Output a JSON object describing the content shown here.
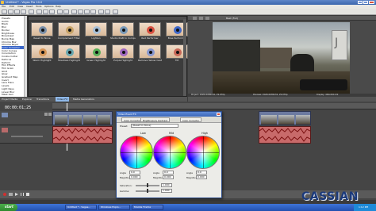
{
  "app": {
    "title": "Untitled * - Vegas Pro 10.0",
    "menu": [
      "File",
      "Edit",
      "View",
      "Insert",
      "Tools",
      "Options",
      "Help"
    ]
  },
  "explorer": {
    "items": [
      "Presets",
      "Audio",
      "Black",
      "Blur",
      "Border",
      "Brightness",
      "Broadcast",
      "Bump Map",
      "Chroma Blur",
      "Chroma Keyer",
      "Color Corrector",
      "Color Curves",
      "Convolution",
      "Cookie Cutter",
      "Defocus",
      "Deform",
      "Film Effects",
      "Film Grain",
      "Glint",
      "Glow",
      "Gradient Map",
      "Invert",
      "Lens Flare",
      "Levels",
      "Light Rays",
      "Linear Blur",
      "Mask Gen"
    ],
    "selected_index": 10
  },
  "fx_presets": [
    {
      "label": "Reset to None",
      "iris": "#7a8fa8"
    },
    {
      "label": "Complement Filter",
      "iris": "#c8a468"
    },
    {
      "label": "Lighten",
      "iris": "#a8c0d8"
    },
    {
      "label": "Studio RGB to Computer RGB",
      "iris": "#7a9ab8"
    },
    {
      "label": "Red Performer",
      "iris": "#d85040"
    },
    {
      "label": "Blue Performer",
      "iris": "#4068c8"
    },
    {
      "label": "Warm Highlight",
      "iris": "#d89858"
    },
    {
      "label": "Shadows Highlight",
      "iris": "#68a8b0"
    },
    {
      "label": "Green Highlight",
      "iris": "#58b058"
    },
    {
      "label": "Purple Highlight",
      "iris": "#a068c0"
    },
    {
      "label": "Remove Yellow Cast",
      "iris": "#8898d0"
    },
    {
      "label": "Tilt",
      "iris": "#c86858"
    }
  ],
  "preview": {
    "resolution_text": "Best (Full)",
    "info_lines": [
      "Project: 1920x1080x32, 29.970p",
      "Preview: 1920x1080x32, 29.970p",
      "Display: 464x261x32"
    ],
    "cross_label": "J"
  },
  "tabs": [
    "Project Media",
    "Explorer",
    "Transitions",
    "Video FX",
    "Media Generators"
  ],
  "time": {
    "current": "00:00:01;25"
  },
  "dialog": {
    "title": "Video Event FX",
    "tabs": [
      "Color Corrector",
      "Brightness & Contrast",
      "Color Corrector"
    ],
    "preset_label": "Preset:",
    "preset_value": "(Reset to None)",
    "wheels": [
      {
        "label": "Low",
        "angle_label": "Angle",
        "angle": "0.0",
        "mag_label": "Magnitude",
        "magnitude": "0.000"
      },
      {
        "label": "Mid",
        "angle_label": "Angle",
        "angle": "0.0",
        "mag_label": "Magnitude",
        "magnitude": "0.000"
      },
      {
        "label": "High",
        "angle_label": "Angle",
        "angle": "0.0",
        "mag_label": "Magnitude",
        "magnitude": "0.000"
      }
    ],
    "saturation_label": "Saturation:",
    "saturation": "1.000",
    "gamma_label": "Gamma:",
    "gamma": "1.000"
  },
  "watermark": "CASSIAN",
  "taskbar": {
    "start": "start",
    "buttons": [
      "Untitled * - Vegas...",
      "Windows Explo...",
      "Mozilla Firefox"
    ],
    "clock": "1:12 PM"
  },
  "colors": {
    "dialog_title": "#4a78c8",
    "taskbar": "#2a5cc8",
    "start_button": "#3c9a3c",
    "video_clip": "#6c7aa0",
    "audio_clip": "#b0282c",
    "watermark": "#1c3a7a"
  }
}
